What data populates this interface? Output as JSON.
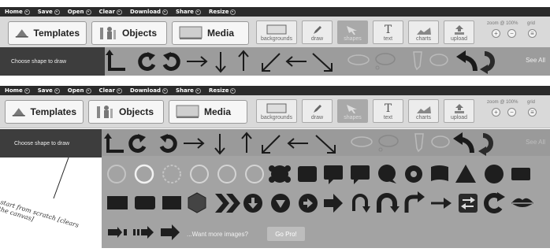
{
  "menu": [
    "Home",
    "Save",
    "Open",
    "Clear",
    "Download",
    "Share",
    "Resize"
  ],
  "toolbar": {
    "templates": "Templates",
    "objects": "Objects",
    "media": "Media",
    "tools": [
      "backgrounds",
      "draw",
      "shapes",
      "text",
      "charts",
      "upload"
    ],
    "zoom_label": "zoom @ 100%",
    "grid_label": "grid",
    "zoom_in": "+",
    "zoom_out": "−",
    "grid_toggle": "≡"
  },
  "shapebar": {
    "label": "Choose shape to draw",
    "see_all": "See All"
  },
  "panel": {
    "more_images": "...Want more images?",
    "go_pro": "Go Pro!"
  },
  "annotation": "start from scratch [clears the canvas]",
  "colors": {
    "menubar": "#2b2b2b",
    "toolbar": "#d9d9d9",
    "shapebar": "#5a5a5a",
    "panel": "#a3a3a3"
  }
}
